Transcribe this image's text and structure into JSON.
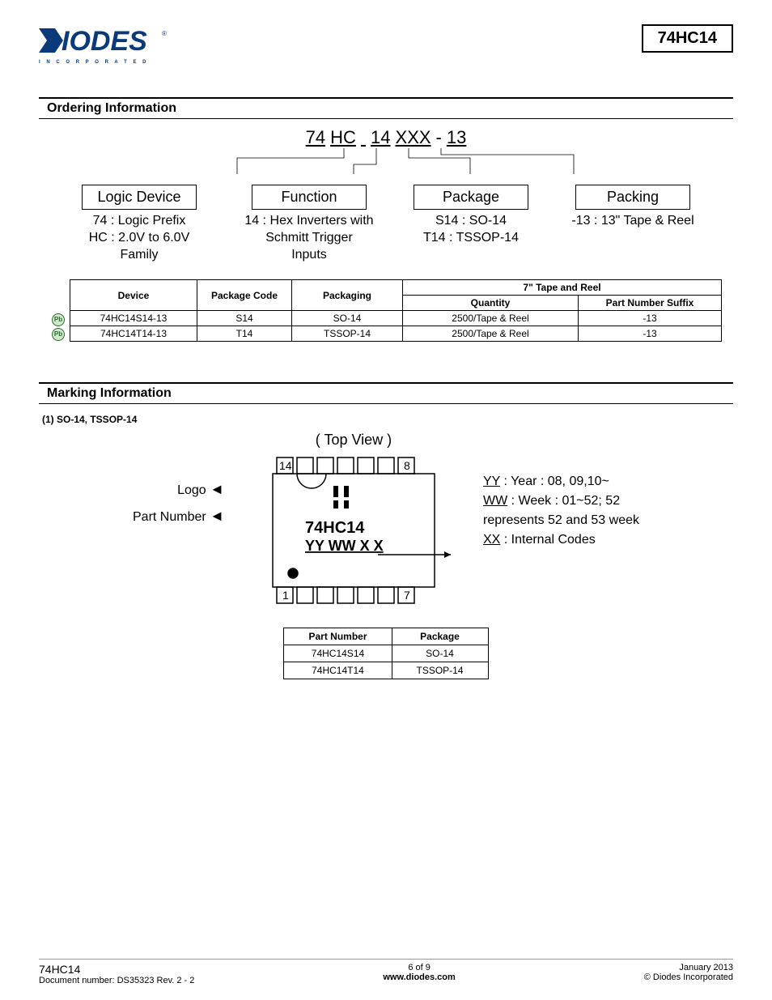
{
  "header": {
    "brand_main": "DIODES",
    "brand_sub": "I N C O R P O R A T E D",
    "part_number": "74HC14"
  },
  "sections": {
    "ordering_title": "Ordering Information",
    "marking_title": "Marking Information"
  },
  "ordering_code": {
    "p1": "74",
    "p2": "HC",
    "p3": "14",
    "p4": "XXX",
    "dash": "-",
    "p5": "13"
  },
  "ordering_boxes": {
    "logic": {
      "label": "Logic Device",
      "desc": "74 : Logic Prefix\nHC : 2.0V to 6.0V\nFamily"
    },
    "function": {
      "label": "Function",
      "desc": "14 : Hex Inverters with\nSchmitt Trigger\nInputs"
    },
    "package": {
      "label": "Package",
      "desc": "S14 : SO-14\nT14 : TSSOP-14"
    },
    "packing": {
      "label": "Packing",
      "desc": "-13 : 13\" Tape & Reel"
    }
  },
  "order_table": {
    "h_device": "Device",
    "h_pkgcode": "Package Code",
    "h_packaging": "Packaging",
    "h_tapereel": "7\" Tape and Reel",
    "h_qty": "Quantity",
    "h_suffix": "Part Number Suffix",
    "rows": [
      {
        "device": "74HC14S14-13",
        "code": "S14",
        "pkg": "SO-14",
        "qty": "2500/Tape & Reel",
        "suffix": "-13"
      },
      {
        "device": "74HC14T14-13",
        "code": "T14",
        "pkg": "TSSOP-14",
        "qty": "2500/Tape & Reel",
        "suffix": "-13"
      }
    ]
  },
  "pb_label": "Pb",
  "marking": {
    "sub": "(1) SO-14, TSSOP-14",
    "topview": "( Top View )",
    "pin14": "14",
    "pin8": "8",
    "pin1": "1",
    "pin7": "7",
    "chip_part": "74HC14",
    "chip_date": "YY WW X X",
    "left_logo": "Logo",
    "left_pn": "Part Number",
    "right_yy": "YY : Year : 08, 09,10~",
    "right_ww": "WW : Week : 01~52; 52",
    "right_ww2": "represents 52 and 53 week",
    "right_xx": "XX :  Internal Codes"
  },
  "marking_table": {
    "h_pn": "Part Number",
    "h_pkg": "Package",
    "rows": [
      {
        "pn": "74HC14S14",
        "pkg": "SO-14"
      },
      {
        "pn": "74HC14T14",
        "pkg": "TSSOP-14"
      }
    ]
  },
  "footer": {
    "left1": "74HC14",
    "left2": "Document number: DS35323  Rev. 2 - 2",
    "mid1": "6 of 9",
    "mid2": "www.diodes.com",
    "right1": "January 2013",
    "right2": "© Diodes Incorporated"
  }
}
